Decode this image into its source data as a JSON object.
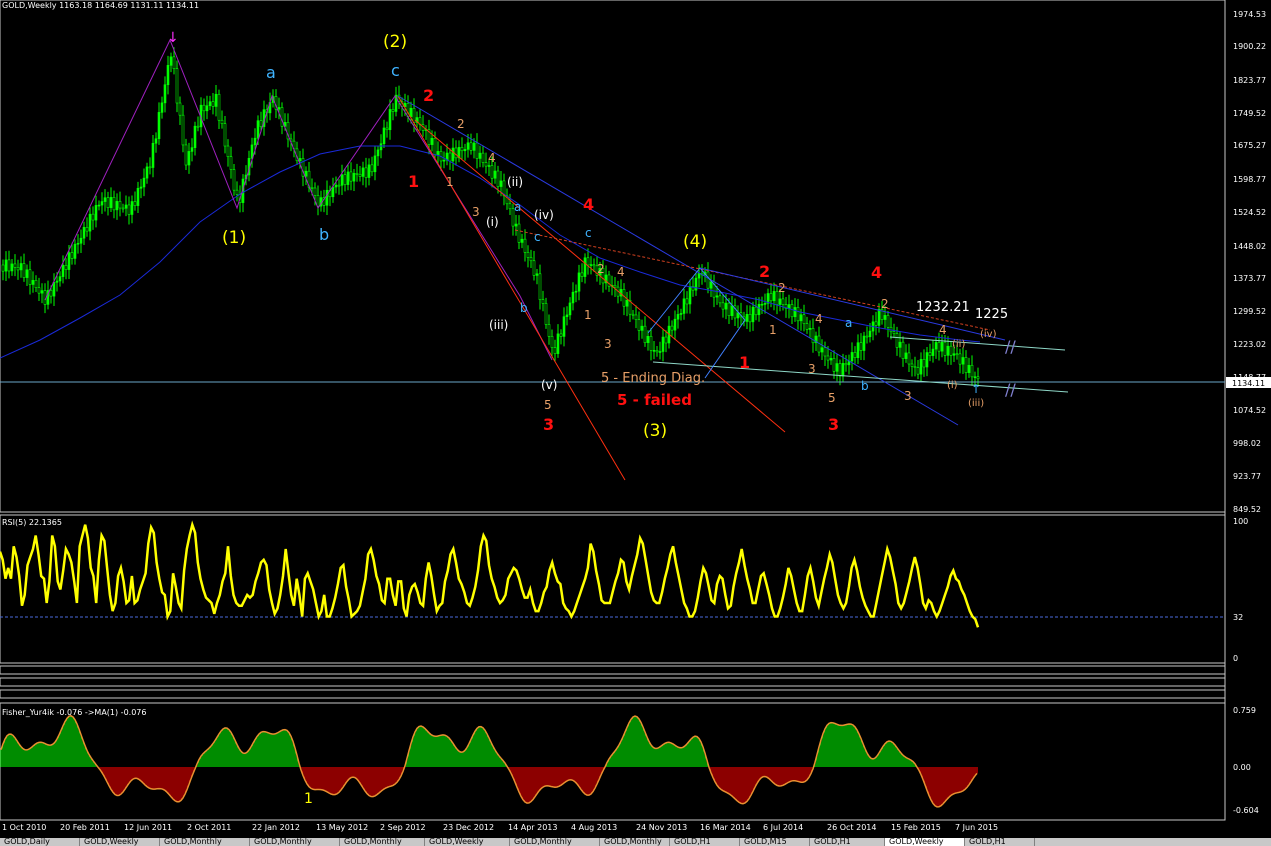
{
  "main": {
    "header": "GOLD,Weekly  1163.18 1164.69 1131.11 1134.11",
    "price_tag": "1134.11",
    "price_axis": [
      "1974.53",
      "1900.22",
      "1823.77",
      "1749.52",
      "1675.27",
      "1598.77",
      "1524.52",
      "1448.02",
      "1373.77",
      "1299.52",
      "1223.02",
      "1148.77",
      "1074.52",
      "998.02",
      "923.77",
      "849.52"
    ],
    "price_min": 849.52,
    "price_max": 1974.53
  },
  "rsi": {
    "header": "RSI(5) 22.1365",
    "axis": [
      "100",
      "32",
      "0"
    ],
    "level": 32,
    "values": [
      78,
      72,
      58,
      66,
      58,
      82,
      74,
      60,
      38,
      46,
      68,
      74,
      80,
      90,
      76,
      60,
      58,
      40,
      56,
      90,
      82,
      56,
      50,
      64,
      80,
      76,
      70,
      56,
      40,
      82,
      90,
      98,
      88,
      66,
      60,
      40,
      72,
      90,
      86,
      66,
      46,
      34,
      40,
      60,
      66,
      56,
      40,
      42,
      60,
      40,
      42,
      50,
      56,
      62,
      84,
      96,
      92,
      70,
      58,
      48,
      46,
      30,
      34,
      62,
      52,
      40,
      36,
      64,
      80,
      90,
      98,
      92,
      70,
      58,
      50,
      44,
      42,
      40,
      32,
      40,
      46,
      56,
      62,
      82,
      60,
      46,
      40,
      38,
      38,
      42,
      46,
      44,
      46,
      56,
      62,
      70,
      72,
      68,
      50,
      40,
      32,
      36,
      46,
      60,
      80,
      62,
      46,
      38,
      58,
      46,
      30,
      58,
      62,
      56,
      50,
      40,
      30,
      34,
      46,
      30,
      30,
      36,
      44,
      54,
      66,
      68,
      52,
      42,
      30,
      32,
      34,
      38,
      48,
      58,
      76,
      80,
      72,
      60,
      54,
      42,
      40,
      58,
      58,
      46,
      38,
      56,
      56,
      36,
      30,
      46,
      52,
      54,
      48,
      40,
      38,
      58,
      70,
      60,
      46,
      34,
      38,
      40,
      56,
      64,
      76,
      80,
      70,
      58,
      54,
      48,
      40,
      38,
      44,
      52,
      64,
      82,
      90,
      86,
      68,
      58,
      52,
      44,
      40,
      42,
      46,
      58,
      62,
      66,
      64,
      58,
      50,
      44,
      44,
      50,
      40,
      34,
      34,
      40,
      48,
      52,
      64,
      70,
      62,
      56,
      54,
      40,
      36,
      34,
      30,
      34,
      40,
      46,
      52,
      58,
      66,
      84,
      78,
      64,
      54,
      42,
      40,
      40,
      40,
      48,
      56,
      62,
      72,
      70,
      56,
      50,
      60,
      68,
      76,
      88,
      84,
      72,
      60,
      48,
      42,
      40,
      40,
      48,
      58,
      66,
      76,
      82,
      70,
      60,
      50,
      40,
      36,
      30,
      30,
      34,
      44,
      56,
      66,
      62,
      52,
      42,
      40,
      54,
      60,
      58,
      46,
      36,
      38,
      52,
      62,
      70,
      80,
      68,
      58,
      50,
      40,
      40,
      50,
      60,
      62,
      54,
      46,
      36,
      30,
      30,
      36,
      44,
      54,
      66,
      60,
      50,
      40,
      34,
      34,
      46,
      60,
      66,
      56,
      44,
      38,
      48,
      58,
      66,
      76,
      70,
      58,
      46,
      40,
      36,
      40,
      52,
      66,
      72,
      64,
      52,
      44,
      38,
      34,
      30,
      30,
      40,
      50,
      60,
      70,
      80,
      74,
      64,
      54,
      40,
      36,
      40,
      48,
      56,
      66,
      74,
      66,
      54,
      40,
      36,
      42,
      40,
      34,
      30,
      34,
      40,
      46,
      52,
      60,
      64,
      58,
      56,
      50,
      46,
      40,
      34,
      30,
      28,
      22
    ],
    "min": 0,
    "max": 100
  },
  "fisher": {
    "header": "Fisher_Yur4ik -0.076  ->MA(1) -0.076",
    "axis": [
      "0.759",
      "0.00",
      "-0.604"
    ],
    "min": -0.604,
    "max": 0.759
  },
  "time_axis": [
    "1 Oct 2010",
    "20 Feb 2011",
    "12 Jun 2011",
    "2 Oct 2011",
    "22 Jan 2012",
    "13 May 2012",
    "2 Sep 2012",
    "23 Dec 2012",
    "14 Apr 2013",
    "4 Aug 2013",
    "24 Nov 2013",
    "16 Mar 2014",
    "6 Jul 2014",
    "26 Oct 2014",
    "15 Feb 2015",
    "7 Jun 2015"
  ],
  "tabs": [
    "GOLD,Daily",
    "GOLD,Weekly",
    "GOLD,Monthly",
    "GOLD,Monthly",
    "GOLD,Monthly",
    "GOLD,Weekly",
    "GOLD,Monthly",
    "GOLD,Monthly",
    "GOLD,H1",
    "GOLD,M15",
    "GOLD,H1",
    "GOLD,Weekly",
    "GOLD,H1"
  ],
  "annotations": {
    "yellow": [
      "(2)",
      "(1)",
      "(4)",
      "(3)"
    ],
    "cyan": [
      "a",
      "c",
      "b",
      "a",
      "b",
      "a",
      "c",
      "b",
      "c"
    ],
    "red": [
      "2",
      "1",
      "4",
      "3",
      "2",
      "1",
      "4",
      "3",
      "5 - failed"
    ],
    "orange": [
      "2",
      "4",
      "1",
      "3",
      "2",
      "4",
      "3",
      "1",
      "2",
      "4",
      "5",
      "2",
      "4",
      "3",
      "1",
      "3",
      "5",
      "(iv)",
      "(iii)",
      "(ii)",
      "(i)",
      "5 - Ending Diag."
    ],
    "white": [
      "(ii)",
      "(i)",
      "(iv)",
      "(iii)",
      "(v)",
      "1232.21",
      "1225"
    ],
    "fisher_label": "1"
  },
  "colors": {
    "bull_candle": "#00ff00",
    "yellow": "#ffff00",
    "cyan": "#3fb3ff",
    "red": "#ff1010",
    "orange": "#e8a068",
    "fisher_up": "#00c800",
    "fisher_down": "#c80000"
  }
}
